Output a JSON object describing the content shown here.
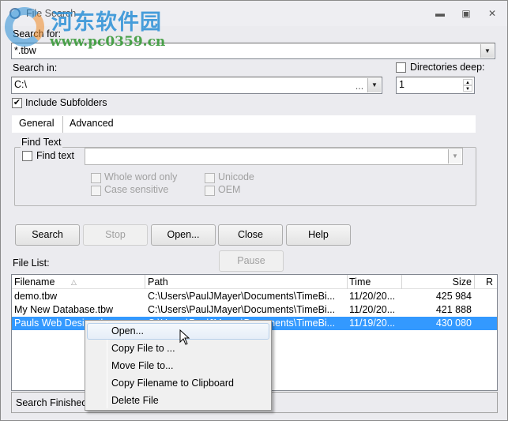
{
  "window": {
    "title": "File Search",
    "controls": [
      "minimize",
      "maximize",
      "close"
    ]
  },
  "watermark": {
    "line1": "河东软件园",
    "line2": "www.pc0359.cn"
  },
  "search_for": {
    "label": "Search for:",
    "value": "*.tbw"
  },
  "search_in": {
    "label": "Search in:",
    "value": "C:\\",
    "browse_label": "..."
  },
  "directories_deep": {
    "label": "Directories deep:",
    "checked": false,
    "value": "1"
  },
  "include_subfolders": {
    "label": "Include Subfolders",
    "checked": true
  },
  "tabs": [
    {
      "label": "General",
      "active": true
    },
    {
      "label": "Advanced",
      "active": false
    }
  ],
  "find_text": {
    "group_label": "Find Text",
    "checkbox_label": "Find text",
    "value": "",
    "options": [
      {
        "label": "Whole word only",
        "checked": false,
        "enabled": false
      },
      {
        "label": "Case sensitive",
        "checked": false,
        "enabled": false
      },
      {
        "label": "Unicode",
        "checked": false,
        "enabled": false
      },
      {
        "label": "OEM",
        "checked": false,
        "enabled": false
      }
    ]
  },
  "buttons": {
    "search": "Search",
    "stop": "Stop",
    "open": "Open...",
    "close": "Close",
    "help": "Help",
    "pause": "Pause"
  },
  "file_list": {
    "label": "File List:",
    "columns": [
      "Filename",
      "Path",
      "Time",
      "Size",
      "R"
    ],
    "sort_column": "Filename",
    "rows": [
      {
        "filename": "demo.tbw",
        "path": "C:\\Users\\PaulJMayer\\Documents\\TimeBi...",
        "time": "11/20/20...",
        "size": "425 984",
        "selected": false
      },
      {
        "filename": "My New Database.tbw",
        "path": "C:\\Users\\PaulJMayer\\Documents\\TimeBi...",
        "time": "11/20/20...",
        "size": "421 888",
        "selected": false
      },
      {
        "filename": "Pauls Web Design.tbw",
        "path": "C:\\Users\\PaulJMayer\\Documents\\TimeBi...",
        "time": "11/19/20...",
        "size": "430 080",
        "selected": true
      }
    ]
  },
  "status": {
    "text": "Search Finished"
  },
  "context_menu": {
    "items": [
      {
        "label": "Open...",
        "hover": true
      },
      {
        "label": "Copy File to ...",
        "hover": false
      },
      {
        "label": "Move File to...",
        "hover": false
      },
      {
        "label": "Copy Filename to Clipboard",
        "hover": false
      },
      {
        "label": "Delete File",
        "hover": false
      }
    ]
  },
  "colors": {
    "selection": "#3399ff",
    "window_bg": "#ebebef"
  }
}
